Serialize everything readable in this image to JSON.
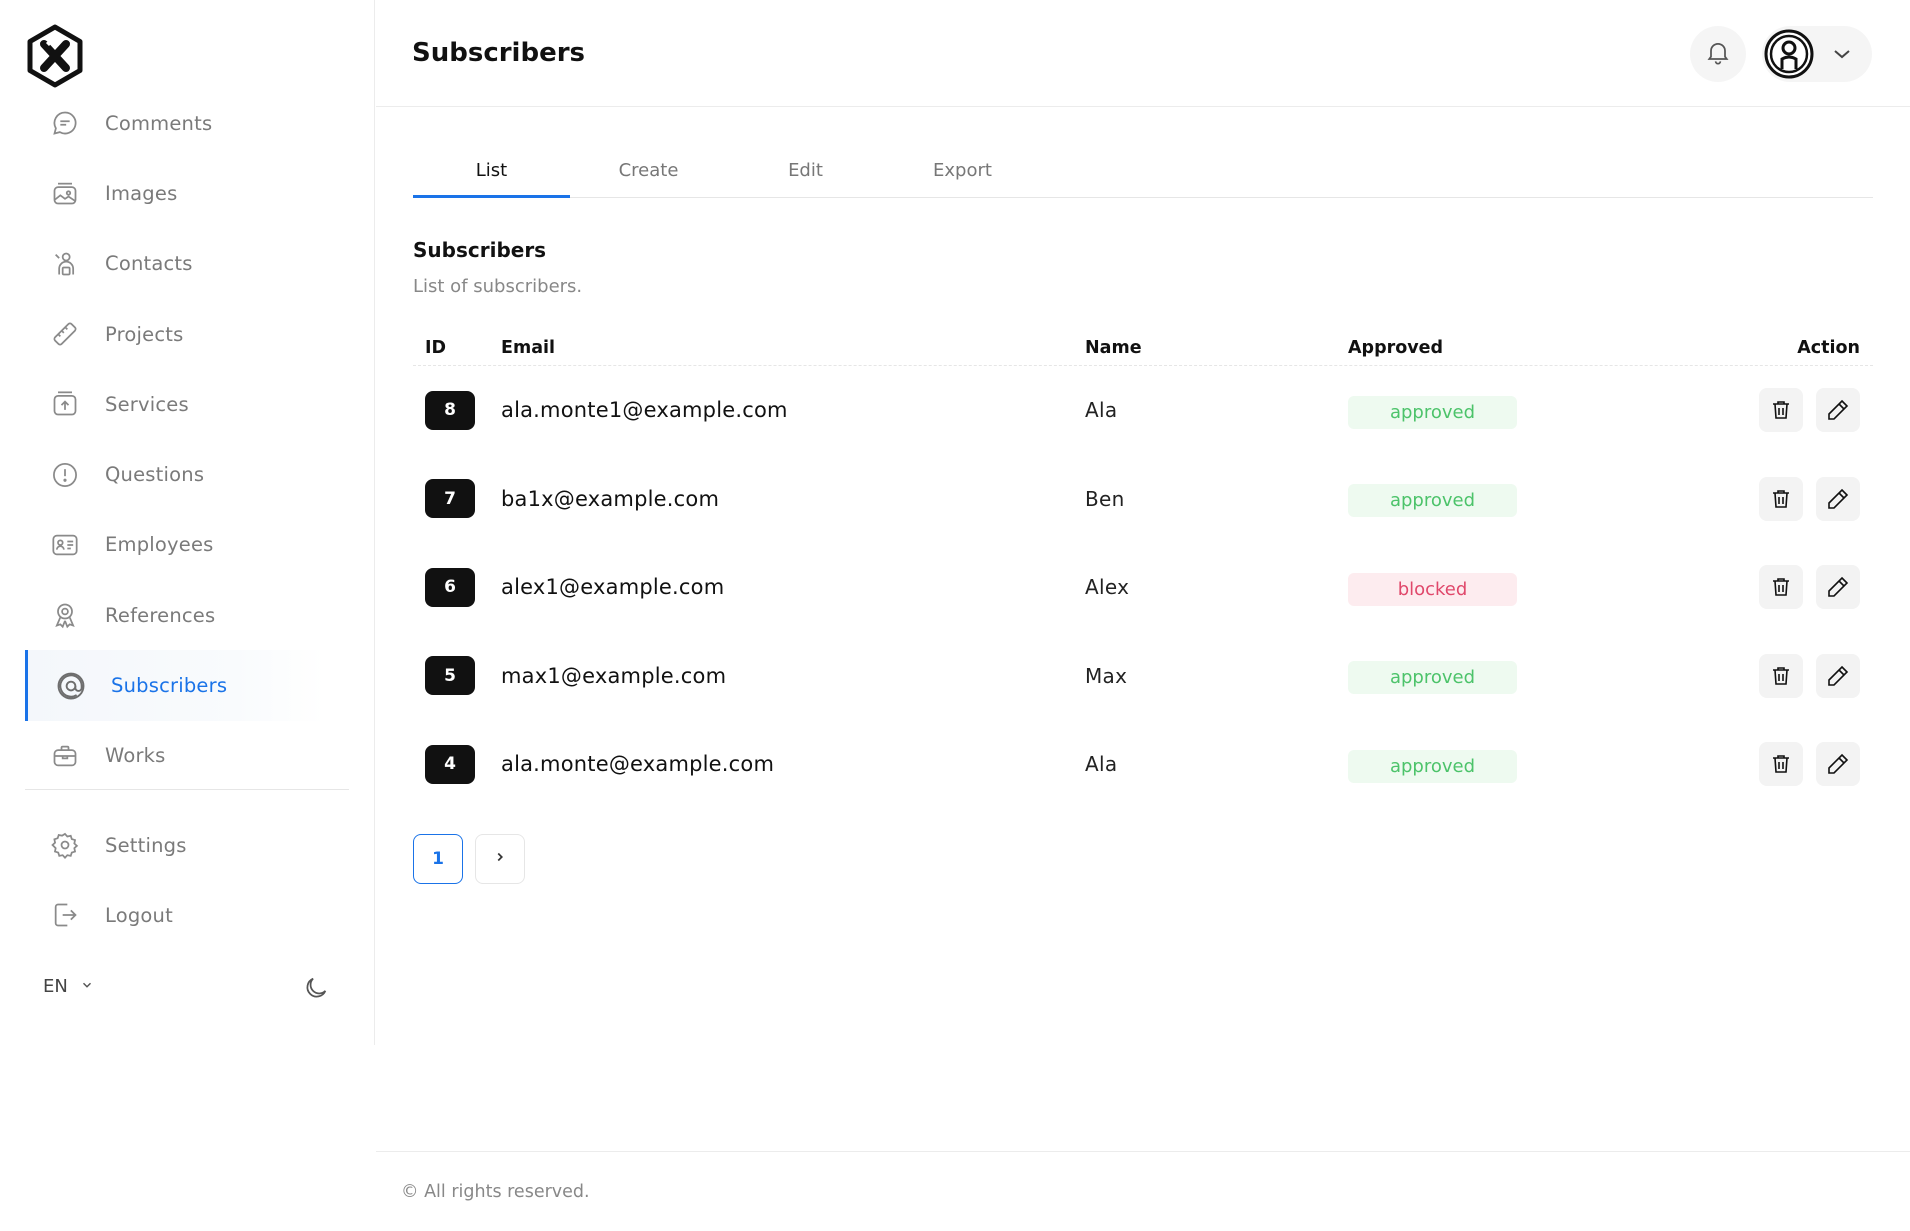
{
  "sidebar": {
    "items": [
      {
        "label": "Comments",
        "icon": "chat-bubble-icon"
      },
      {
        "label": "Images",
        "icon": "images-icon"
      },
      {
        "label": "Contacts",
        "icon": "contacts-icon"
      },
      {
        "label": "Projects",
        "icon": "ruler-icon"
      },
      {
        "label": "Services",
        "icon": "upload-box-icon"
      },
      {
        "label": "Questions",
        "icon": "question-circle-icon"
      },
      {
        "label": "Employees",
        "icon": "id-card-icon"
      },
      {
        "label": "References",
        "icon": "award-icon"
      },
      {
        "label": "Subscribers",
        "icon": "at-sign-icon",
        "active": true
      },
      {
        "label": "Works",
        "icon": "briefcase-icon"
      }
    ],
    "bottom_items": [
      {
        "label": "Settings",
        "icon": "gear-icon"
      },
      {
        "label": "Logout",
        "icon": "logout-icon"
      }
    ],
    "language": "EN"
  },
  "header": {
    "title": "Subscribers"
  },
  "tabs": [
    {
      "label": "List",
      "active": true
    },
    {
      "label": "Create"
    },
    {
      "label": "Edit"
    },
    {
      "label": "Export"
    }
  ],
  "section": {
    "title": "Subscribers",
    "subtitle": "List of subscribers."
  },
  "table": {
    "columns": [
      "ID",
      "Email",
      "Name",
      "Approved",
      "Action"
    ],
    "rows": [
      {
        "id": "8",
        "email": "ala.monte1@example.com",
        "name": "Ala",
        "status": "approved"
      },
      {
        "id": "7",
        "email": "ba1x@example.com",
        "name": "Ben",
        "status": "approved"
      },
      {
        "id": "6",
        "email": "alex1@example.com",
        "name": "Alex",
        "status": "blocked"
      },
      {
        "id": "5",
        "email": "max1@example.com",
        "name": "Max",
        "status": "approved"
      },
      {
        "id": "4",
        "email": "ala.monte@example.com",
        "name": "Ala",
        "status": "approved"
      }
    ]
  },
  "pagination": {
    "current": "1",
    "next": "›"
  },
  "footer": {
    "text": "© All rights reserved."
  },
  "colors": {
    "accent": "#1a73e8",
    "approved_text": "#4cc36a",
    "approved_bg": "#eefaf0",
    "blocked_text": "#e0486b",
    "blocked_bg": "#fdecef"
  }
}
